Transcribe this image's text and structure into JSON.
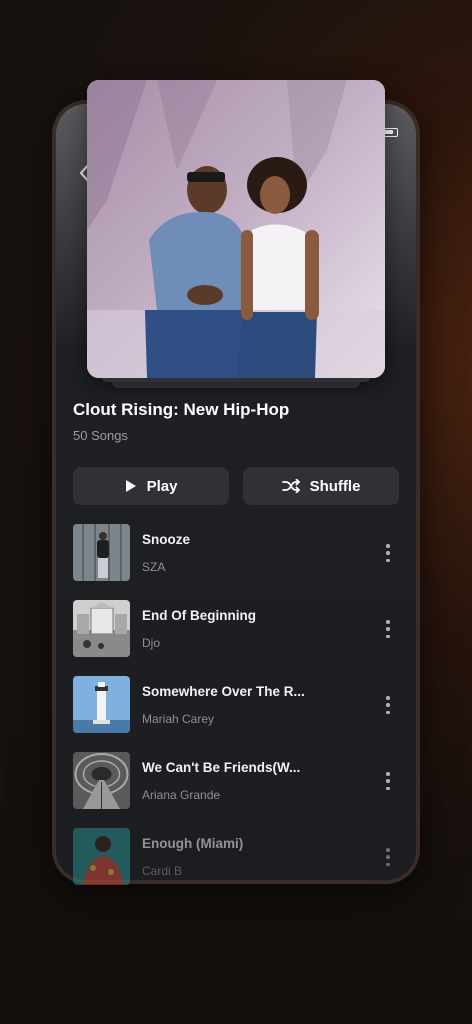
{
  "playlist": {
    "title": "Clout Rising: New Hip-Hop",
    "count": "50 Songs"
  },
  "actions": {
    "play_label": "Play",
    "shuffle_label": "Shuffle"
  },
  "tracks": [
    {
      "title": "Snooze",
      "artist": "SZA"
    },
    {
      "title": "End Of Beginning",
      "artist": "Djo"
    },
    {
      "title": "Somewhere Over The R...",
      "artist": "Mariah Carey"
    },
    {
      "title": "We Can't Be Friends(W...",
      "artist": "Ariana Grande"
    },
    {
      "title": "Enough (Miami)",
      "artist": "Cardi B"
    }
  ],
  "icons": {
    "back": "chevron-left-icon",
    "battery": "battery-icon",
    "play": "play-icon",
    "shuffle": "shuffle-icon",
    "more": "more-vertical-icon"
  },
  "colors": {
    "background": "#1c1d21",
    "button": "#2f3137",
    "secondary_text": "#9b9ca2"
  }
}
